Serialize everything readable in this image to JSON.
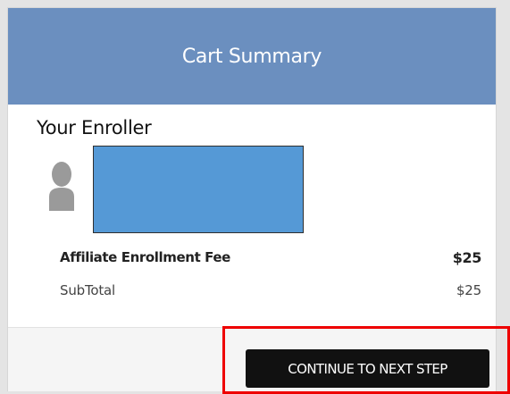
{
  "header": {
    "title": "Cart Summary"
  },
  "enroller": {
    "title": "Your Enroller",
    "avatar_icon": "person-silhouette-icon",
    "redaction_color": "#5599d6"
  },
  "line_items": [
    {
      "label": "Affiliate Enrollment Fee",
      "amount": "$25"
    },
    {
      "label": "SubTotal",
      "amount": "$25"
    }
  ],
  "footer": {
    "continue_label": "CONTINUE TO NEXT STEP"
  },
  "colors": {
    "header_bg": "#6b8fbf",
    "button_bg": "#111111",
    "highlight": "#ee0000"
  }
}
